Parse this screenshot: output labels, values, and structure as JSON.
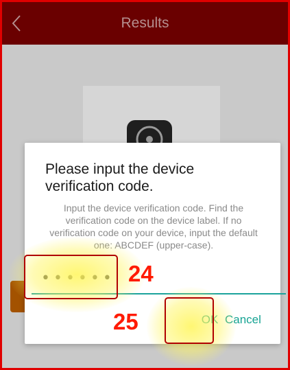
{
  "app_bar": {
    "title": "Results",
    "back_icon": "chevron-left-icon"
  },
  "dialog": {
    "title": "Please input the device verification code.",
    "message": "Input the device verification code. Find the verification code on the device label. If no verification code on your device, input the default one: ABCDEF (upper-case).",
    "input_value": "••••••",
    "ok_label": "OK",
    "cancel_label": "Cancel"
  },
  "annotations": {
    "input_step": "24",
    "ok_step": "25"
  },
  "colors": {
    "app_bar": "#6a0000",
    "accent": "#16a393",
    "annotation": "#ff1a00",
    "highlight": "#fff55a"
  }
}
